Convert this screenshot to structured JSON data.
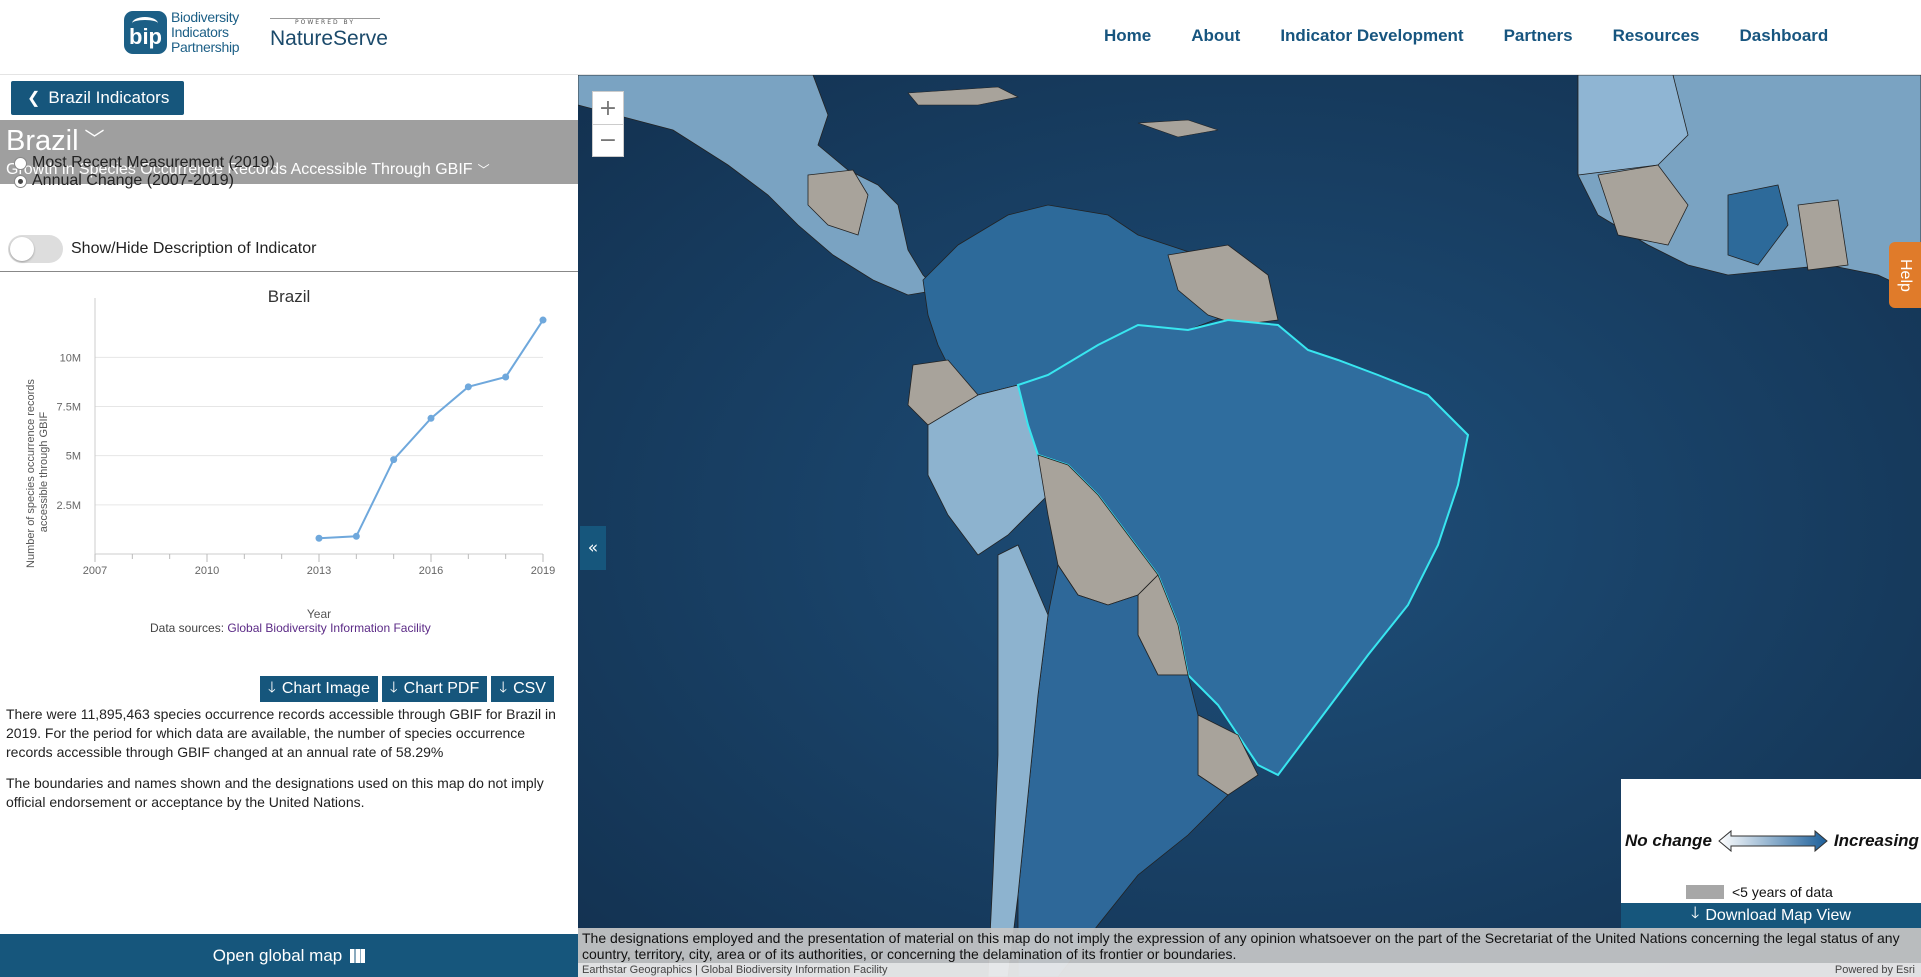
{
  "header": {
    "logo_badge": "bip",
    "logo_lines": [
      "Biodiversity",
      "Indicators",
      "Partnership"
    ],
    "powered_by": "POWERED BY",
    "natureserve": "NatureServe",
    "nav": [
      "Home",
      "About",
      "Indicator Development",
      "Partners",
      "Resources",
      "Dashboard"
    ]
  },
  "panel": {
    "back_label": "Brazil Indicators",
    "country": "Brazil",
    "indicator": "Growth in Species Occurrence Records Accessible Through GBIF",
    "options": [
      {
        "label": "Most Recent Measurement (2019)",
        "selected": false
      },
      {
        "label": "Annual Change (2007-2019)",
        "selected": true
      }
    ],
    "toggle_label": "Show/Hide Description of Indicator",
    "downloads": [
      "Chart Image",
      "Chart PDF",
      "CSV"
    ],
    "description": "There were 11,895,463 species occurrence records accessible through GBIF for Brazil in 2019. For the period for which data are available, the number of species occurrence records accessible through GBIF changed at an annual rate of 58.29%",
    "disclaimer": "The boundaries and names shown and the designations used on this map do not imply official endorsement or acceptance by the United Nations.",
    "open_map": "Open global map"
  },
  "chart_data": {
    "type": "line",
    "title": "Brazil",
    "xlabel": "Year",
    "ylabel": "Number of species occurrence records accessible through GBIF",
    "x": [
      2013,
      2014,
      2015,
      2016,
      2017,
      2018,
      2019
    ],
    "values": [
      800000,
      900000,
      4800000,
      6900000,
      8500000,
      9000000,
      11895463
    ],
    "xlim": [
      2007,
      2019
    ],
    "ylim": [
      0,
      12000000
    ],
    "xticks": [
      "2007",
      "2010",
      "2013",
      "2016",
      "2019"
    ],
    "yticks": [
      {
        "value": 2500000,
        "label": "2.5M"
      },
      {
        "value": 5000000,
        "label": "5M"
      },
      {
        "value": 7500000,
        "label": "7.5M"
      },
      {
        "value": 10000000,
        "label": "10M"
      }
    ],
    "grid": true,
    "source_prefix": "Data sources: ",
    "source_link": "Global Biodiversity Information Facility",
    "color": "#6fa8dc"
  },
  "map": {
    "zoom_in": "+",
    "zoom_out": "−",
    "collapse": "«",
    "help": "Help",
    "legend": {
      "left": "No change",
      "right": "Increasing",
      "swatch_label": "<5 years of data"
    },
    "download": "Download Map View",
    "disclaimer": "The designations employed and the presentation of material on this map do not imply the expression of any opinion whatsoever on the part of the Secretariat of the United Nations concerning the legal status of any country, territory, city, area or of its authorities, or concerning the delamination of its frontier or boundaries.",
    "attribution": "Earthstar Geographics | Global Biodiversity Information Facility",
    "esri": "Powered by Esri"
  }
}
